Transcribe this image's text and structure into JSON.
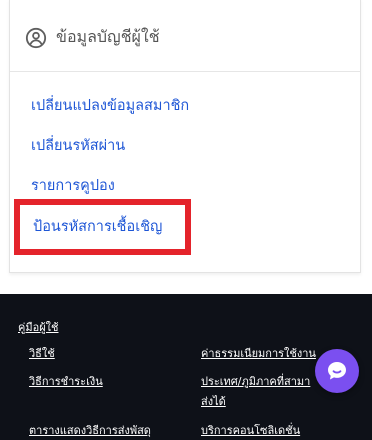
{
  "account_card": {
    "header_title": "ข้อมูลบัญชีผู้ใช้",
    "header_icon": "account-circle-icon",
    "menu": [
      "เปลี่ยนแปลงข้อมูลสมาชิก",
      "เปลี่ยนรหัสผ่าน",
      "รายการคูปอง",
      "ป้อนรหัสการเชื้อเชิญ"
    ],
    "highlighted_item_index": 3,
    "accent_color": "#1e56d6",
    "highlight_color": "#e4232b"
  },
  "footer": {
    "heading": "คู่มือผู้ใช้",
    "left_links": [
      "วิธีใช้",
      "วิธีการชำระเงิน",
      "ตารางแสดงวิธีการส่งพัสดุ"
    ],
    "right_links": [
      "ค่าธรรมเนียมการใช้งาน",
      "ประเทศ/ภูมิภาคที่สามา",
      "ส่งได้",
      "บริการคอนโซลิเดชั่น"
    ],
    "background_color": "#0e1118",
    "chat_button_icon": "chat-bubble-icon",
    "chat_button_color": "#7b4ff0"
  }
}
